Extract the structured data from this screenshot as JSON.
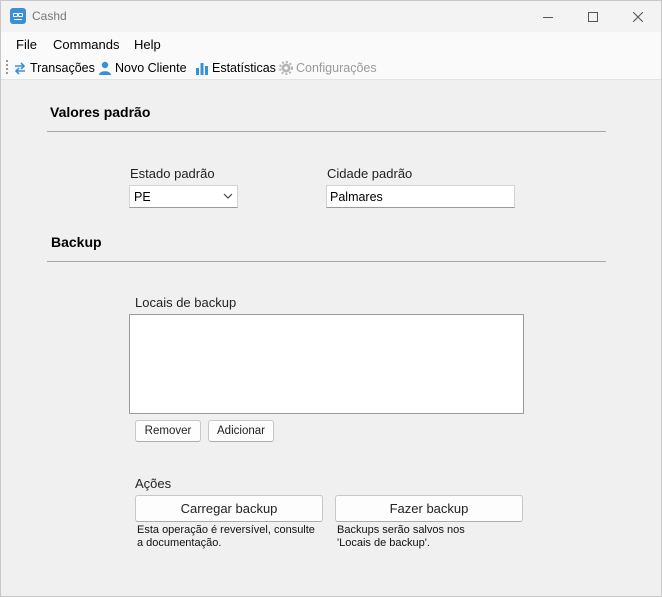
{
  "window": {
    "title": "Cashd"
  },
  "menu": [
    "File",
    "Commands",
    "Help"
  ],
  "toolbar": {
    "transacoes": "Transações",
    "novo_cliente": "Novo Cliente",
    "estatisticas": "Estatísticas",
    "configuracoes": "Configurações"
  },
  "valores": {
    "title": "Valores padrão",
    "estado_label": "Estado padrão",
    "estado_value": "PE",
    "cidade_label": "Cidade padrão",
    "cidade_value": "Palmares"
  },
  "backup": {
    "title": "Backup",
    "locais_label": "Locais de backup",
    "remover": "Remover",
    "adicionar": "Adicionar",
    "acoes_label": "Ações",
    "carregar": "Carregar backup",
    "fazer": "Fazer backup",
    "carregar_note": "Esta operação é reversível, consulte\na documentação.",
    "fazer_note": "Backups serão salvos nos\n'Locais de backup'."
  },
  "colors": {
    "accent": "#3a8fd9",
    "disabled": "#9a9a9a"
  }
}
